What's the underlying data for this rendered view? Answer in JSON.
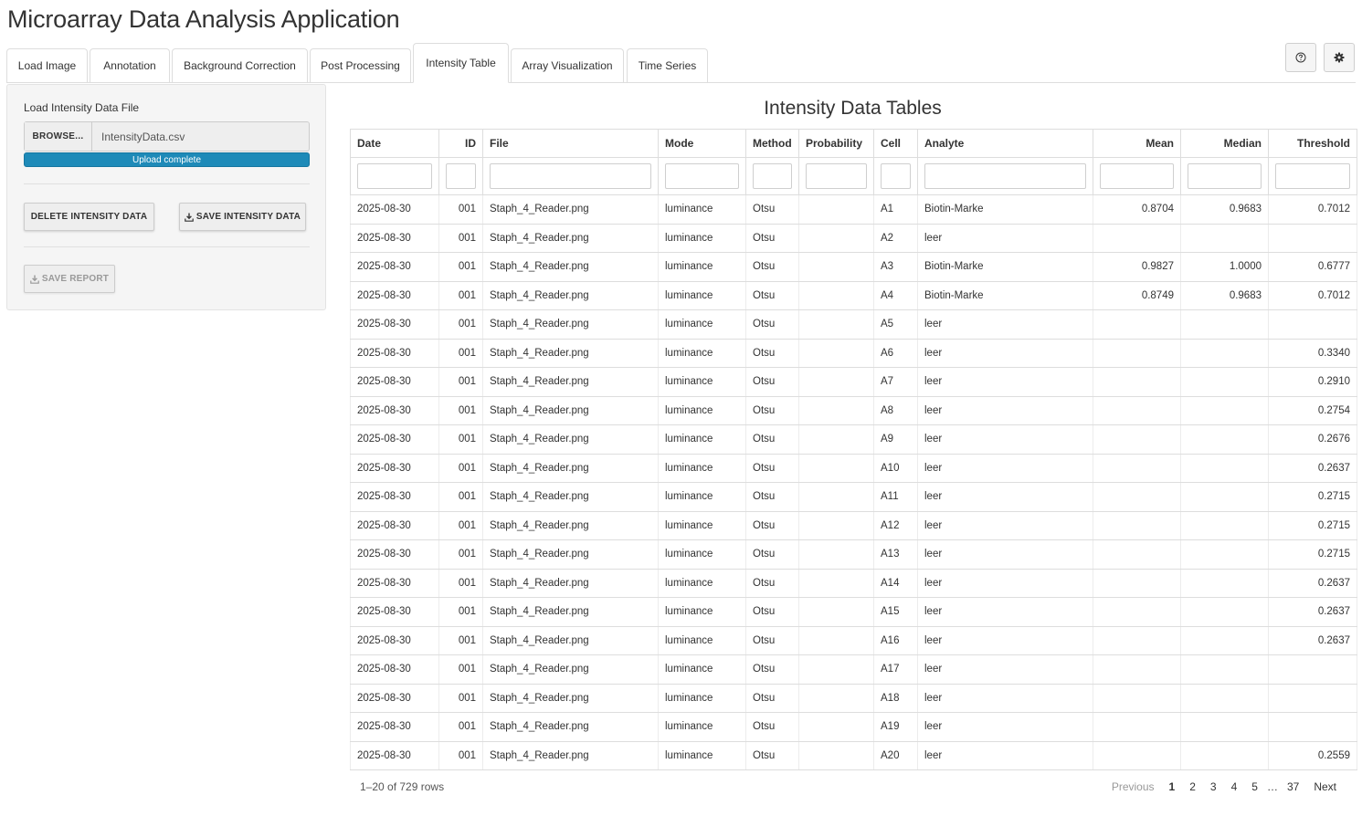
{
  "app_title": "Microarray Data Analysis Application",
  "tabs": [
    {
      "label": "Load Image"
    },
    {
      "label": "Annotation"
    },
    {
      "label": "Background Correction"
    },
    {
      "label": "Post Processing"
    },
    {
      "label": "Intensity Table",
      "active": true
    },
    {
      "label": "Array Visualization"
    },
    {
      "label": "Time Series"
    }
  ],
  "toolbar": {
    "help_icon": "question-circle-icon",
    "settings_icon": "gear-icon"
  },
  "sidebar": {
    "load_label": "Load Intensity Data File",
    "browse_label": "BROWSE...",
    "file_name": "IntensityData.csv",
    "upload_status": "Upload complete",
    "upload_progress": 1.0,
    "delete_label": "DELETE INTENSITY DATA",
    "save_label": "SAVE INTENSITY DATA",
    "report_label": "SAVE REPORT"
  },
  "table": {
    "title": "Intensity Data Tables",
    "columns": [
      "Date",
      "ID",
      "File",
      "Mode",
      "Method",
      "Probability",
      "Cell",
      "Analyte",
      "Mean",
      "Median",
      "Threshold"
    ],
    "rows": [
      [
        "2025-08-30",
        "001",
        "Staph_4_Reader.png",
        "luminance",
        "Otsu",
        "",
        "A1",
        "Biotin-Marke",
        "0.8704",
        "0.9683",
        "0.7012"
      ],
      [
        "2025-08-30",
        "001",
        "Staph_4_Reader.png",
        "luminance",
        "Otsu",
        "",
        "A2",
        "leer",
        "",
        "",
        ""
      ],
      [
        "2025-08-30",
        "001",
        "Staph_4_Reader.png",
        "luminance",
        "Otsu",
        "",
        "A3",
        "Biotin-Marke",
        "0.9827",
        "1.0000",
        "0.6777"
      ],
      [
        "2025-08-30",
        "001",
        "Staph_4_Reader.png",
        "luminance",
        "Otsu",
        "",
        "A4",
        "Biotin-Marke",
        "0.8749",
        "0.9683",
        "0.7012"
      ],
      [
        "2025-08-30",
        "001",
        "Staph_4_Reader.png",
        "luminance",
        "Otsu",
        "",
        "A5",
        "leer",
        "",
        "",
        ""
      ],
      [
        "2025-08-30",
        "001",
        "Staph_4_Reader.png",
        "luminance",
        "Otsu",
        "",
        "A6",
        "leer",
        "",
        "",
        "0.3340"
      ],
      [
        "2025-08-30",
        "001",
        "Staph_4_Reader.png",
        "luminance",
        "Otsu",
        "",
        "A7",
        "leer",
        "",
        "",
        "0.2910"
      ],
      [
        "2025-08-30",
        "001",
        "Staph_4_Reader.png",
        "luminance",
        "Otsu",
        "",
        "A8",
        "leer",
        "",
        "",
        "0.2754"
      ],
      [
        "2025-08-30",
        "001",
        "Staph_4_Reader.png",
        "luminance",
        "Otsu",
        "",
        "A9",
        "leer",
        "",
        "",
        "0.2676"
      ],
      [
        "2025-08-30",
        "001",
        "Staph_4_Reader.png",
        "luminance",
        "Otsu",
        "",
        "A10",
        "leer",
        "",
        "",
        "0.2637"
      ],
      [
        "2025-08-30",
        "001",
        "Staph_4_Reader.png",
        "luminance",
        "Otsu",
        "",
        "A11",
        "leer",
        "",
        "",
        "0.2715"
      ],
      [
        "2025-08-30",
        "001",
        "Staph_4_Reader.png",
        "luminance",
        "Otsu",
        "",
        "A12",
        "leer",
        "",
        "",
        "0.2715"
      ],
      [
        "2025-08-30",
        "001",
        "Staph_4_Reader.png",
        "luminance",
        "Otsu",
        "",
        "A13",
        "leer",
        "",
        "",
        "0.2715"
      ],
      [
        "2025-08-30",
        "001",
        "Staph_4_Reader.png",
        "luminance",
        "Otsu",
        "",
        "A14",
        "leer",
        "",
        "",
        "0.2637"
      ],
      [
        "2025-08-30",
        "001",
        "Staph_4_Reader.png",
        "luminance",
        "Otsu",
        "",
        "A15",
        "leer",
        "",
        "",
        "0.2637"
      ],
      [
        "2025-08-30",
        "001",
        "Staph_4_Reader.png",
        "luminance",
        "Otsu",
        "",
        "A16",
        "leer",
        "",
        "",
        "0.2637"
      ],
      [
        "2025-08-30",
        "001",
        "Staph_4_Reader.png",
        "luminance",
        "Otsu",
        "",
        "A17",
        "leer",
        "",
        "",
        ""
      ],
      [
        "2025-08-30",
        "001",
        "Staph_4_Reader.png",
        "luminance",
        "Otsu",
        "",
        "A18",
        "leer",
        "",
        "",
        ""
      ],
      [
        "2025-08-30",
        "001",
        "Staph_4_Reader.png",
        "luminance",
        "Otsu",
        "",
        "A19",
        "leer",
        "",
        "",
        ""
      ],
      [
        "2025-08-30",
        "001",
        "Staph_4_Reader.png",
        "luminance",
        "Otsu",
        "",
        "A20",
        "leer",
        "",
        "",
        "0.2559"
      ]
    ],
    "info": "1–20 of 729 rows"
  },
  "pagination": {
    "previous": "Previous",
    "pages": [
      "1",
      "2",
      "3",
      "4",
      "5"
    ],
    "ellipsis": "…",
    "last": "37",
    "next": "Next",
    "current": "1"
  },
  "colors": {
    "accent": "#1e8ab8",
    "panel": "#f5f5f5",
    "border": "#dddddd"
  }
}
